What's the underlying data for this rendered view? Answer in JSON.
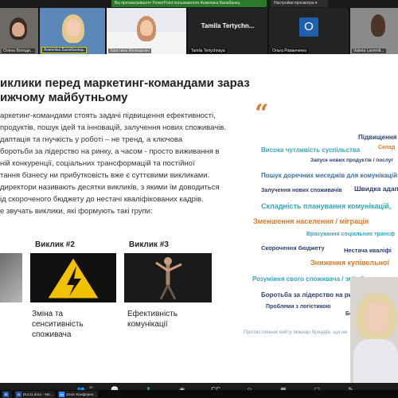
{
  "share_bar": {
    "notice": "Вы просматриваете PowerPoint пользователя Анжелика Балабанец",
    "options": "Настройки просмотра ▾"
  },
  "gallery": [
    {
      "name": "Олена Володи..."
    },
    {
      "name": "Анжеліка Балабанець"
    },
    {
      "name": "Христина Мілющенко"
    },
    {
      "name": "Tamila Tertychnaya",
      "big_label": "Tamila Tertychn..."
    },
    {
      "name": "Ольга Романченко",
      "initial": "O"
    },
    {
      "name": "Valeria Lavrenti..."
    }
  ],
  "slide": {
    "title_line1": "иклики перед маркетинг-командами зараз",
    "title_line2": "ижчому майбутньому",
    "quote_glyph": "“",
    "body": [
      "аркетинг-командами стоять задачі підвищення ефективності,",
      "продуктів, пошук ідей та інновацій, залучення нових споживачів.",
      "даптація та гнучкість у роботі – не тренд, а ключова",
      "боротьби за лідерство на ринку, а часом - просто виживання в",
      "ній конкуренції, соціальних трансформацій та постійної",
      "тання бізнесу ни прибутковість вже є суттєвими викликами.",
      "директори називають десятки викликів, з якими їм доводиться",
      "ід скороченого бюджету до нестачі кваліфікованих кадрів.",
      "е звучать виклики, які формують такі групи:"
    ],
    "cards": [
      {
        "title": "",
        "caption": ""
      },
      {
        "title": "Виклик #2",
        "caption_l1": "Зміна та",
        "caption_l2": "сенситивність",
        "caption_l3": "споживача"
      },
      {
        "title": "Виклик #3",
        "caption_l1": "Ефективність",
        "caption_l2": "комунікації",
        "caption_l3": ""
      }
    ],
    "cloud": [
      {
        "text": "Підвищення",
        "color": "#2e3f6e"
      },
      {
        "text": "Висока чутливість суспільства",
        "color": "#35a8b8"
      },
      {
        "text": "Склад",
        "color": "#e07a2a"
      },
      {
        "text": "Запуск нових продуктів / послуг",
        "color": "#2e3f6e"
      },
      {
        "text": "Пошук доречних меседжів для комунікацій",
        "color": "#3a6fa8"
      },
      {
        "text": "Залучення нових споживачів",
        "color": "#2e3f6e"
      },
      {
        "text": "Швидка адап",
        "color": "#2e3f6e"
      },
      {
        "text": "Складність планування комунікацій,",
        "color": "#35a8b8"
      },
      {
        "text": "Зменшення населення / міграція",
        "color": "#e07a2a"
      },
      {
        "text": "Врахування соціальних трансф",
        "color": "#35a8b8"
      },
      {
        "text": "Скорочення бюджету",
        "color": "#2e3f6e"
      },
      {
        "text": "Нестача кваліфі",
        "color": "#2e3f6e"
      },
      {
        "text": "Зниження купівельної",
        "color": "#e07a2a"
      },
      {
        "text": "Розуміння свого споживача / змін його пов",
        "color": "#35a8b8"
      },
      {
        "text": "Боротьба за лідерство на ринку / конкуренц",
        "color": "#2e3f6e"
      },
      {
        "text": "Проблеми з логістикою",
        "color": "#2e3f6e"
      },
      {
        "text": "Безпек",
        "color": "#2e3f6e"
      },
      {
        "text": "Протистояння хейту міжнар.брендів, що не",
        "color": "#7b9fc4"
      }
    ]
  },
  "toolbar": {
    "participants_count": "52",
    "items": [
      {
        "label": "",
        "icon": "mic-icon"
      },
      {
        "label": "",
        "icon": "video-icon"
      },
      {
        "label": "Участники",
        "icon": "participants-icon"
      },
      {
        "label": "Чат",
        "icon": "chat-icon"
      },
      {
        "label": "Демонстрация экрана",
        "icon": "share-screen-icon"
      },
      {
        "label": "Запись",
        "icon": "record-icon"
      },
      {
        "label": "Показать субтитры",
        "icon": "cc-icon"
      },
      {
        "label": "Реакции",
        "icon": "reaction-icon"
      },
      {
        "label": "Приложения",
        "icon": "apps-icon"
      },
      {
        "label": "Доски сообщений",
        "icon": "whiteboard-icon"
      },
      {
        "label": "Приложения",
        "icon": "notes-icon"
      },
      {
        "label": "Выйти",
        "icon": "leave-icon"
      }
    ]
  },
  "taskbar": [
    {
      "label": "",
      "icon": "start-icon"
    },
    {
      "label": "Doc11.docx - Mic...",
      "icon": "word-icon"
    },
    {
      "label": "Zoom Конферен...",
      "icon": "zoom-icon"
    }
  ],
  "colors": {
    "accent_orange": "#e07a2a",
    "teal": "#35a8b8",
    "navy": "#2e3f6e",
    "zoom_blue": "#2d8cff",
    "share_green": "#23c552"
  }
}
